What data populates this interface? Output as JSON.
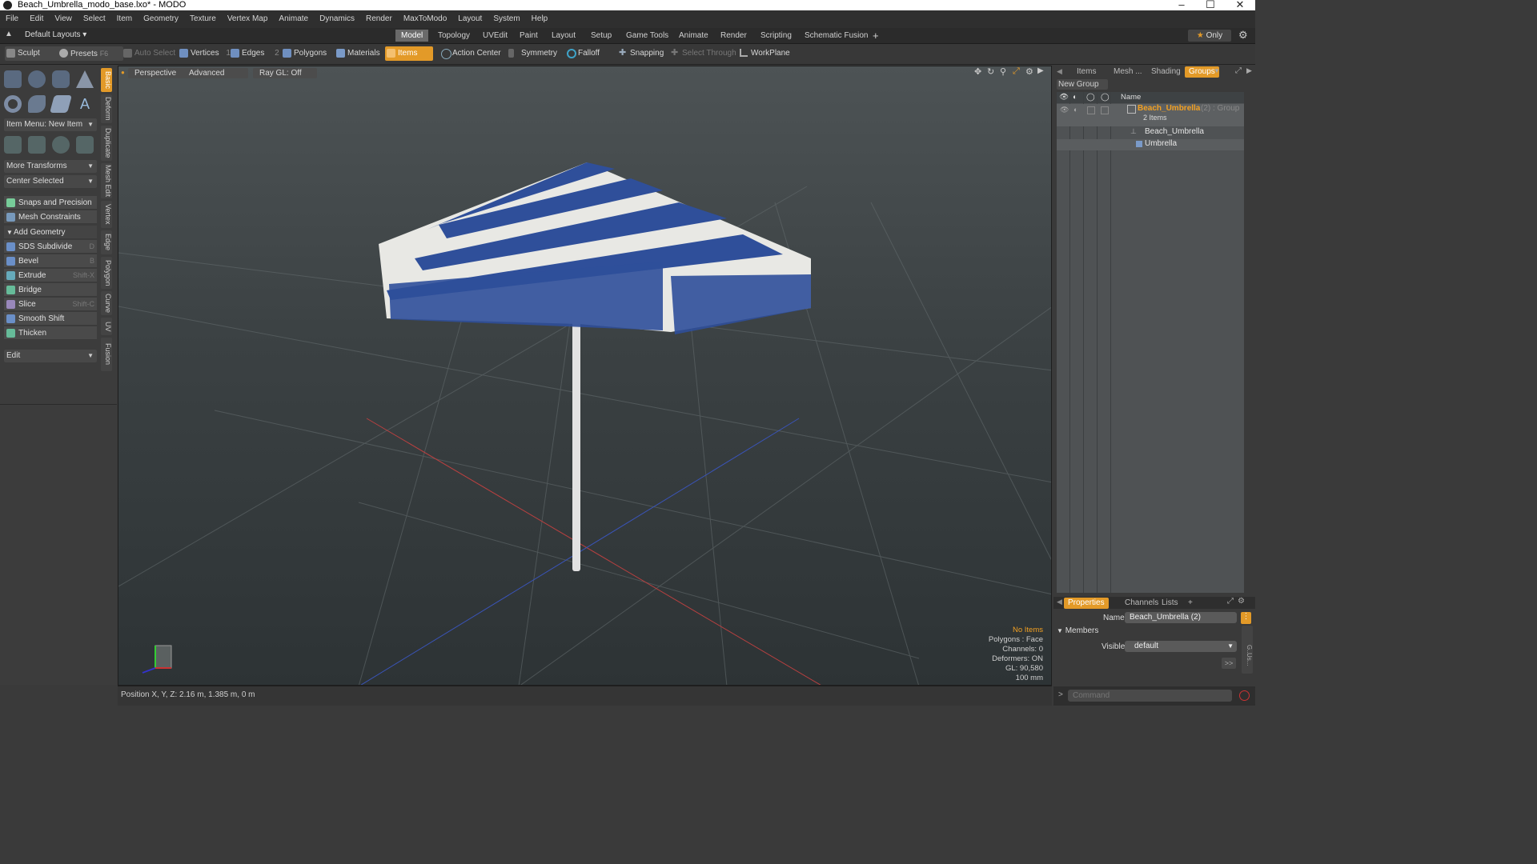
{
  "window": {
    "title": "Beach_Umbrella_modo_base.lxo* - MODO"
  },
  "menu": [
    "File",
    "Edit",
    "View",
    "Select",
    "Item",
    "Geometry",
    "Texture",
    "Vertex Map",
    "Animate",
    "Dynamics",
    "Render",
    "MaxToModo",
    "Layout",
    "System",
    "Help"
  ],
  "layoutbar": {
    "default_layouts": "Default Layouts",
    "tabs": [
      "Model",
      "Topology",
      "UVEdit",
      "Paint",
      "Layout",
      "Setup",
      "Game Tools",
      "Animate",
      "Render",
      "Scripting",
      "Schematic Fusion"
    ],
    "active_tab": "Model",
    "plus": "+",
    "only": "Only",
    "star": "★"
  },
  "toolbar": {
    "sculpt": "Sculpt",
    "presets": "Presets",
    "presets_key": "F6",
    "auto_select": "Auto Select",
    "vertices": "Vertices",
    "vertices_count": "1",
    "edges": "Edges",
    "edges_count": "2",
    "polygons": "Polygons",
    "materials": "Materials",
    "items": "Items",
    "action_center": "Action Center",
    "symmetry": "Symmetry",
    "falloff": "Falloff",
    "snapping": "Snapping",
    "select_through": "Select Through",
    "workplane": "WorkPlane"
  },
  "leftpanel": {
    "item_menu": "Item Menu: New Item",
    "more_transforms": "More Transforms",
    "center_selected": "Center Selected",
    "snaps": "Snaps and Precision",
    "mesh_constraints": "Mesh Constraints",
    "add_geometry": "Add Geometry",
    "tools": [
      {
        "label": "SDS Subdivide",
        "key": "D"
      },
      {
        "label": "Bevel",
        "key": "B"
      },
      {
        "label": "Extrude",
        "key": "Shift-X"
      },
      {
        "label": "Bridge",
        "key": ""
      },
      {
        "label": "Slice",
        "key": "Shift-C"
      },
      {
        "label": "Smooth Shift",
        "key": ""
      },
      {
        "label": "Thicken",
        "key": ""
      }
    ],
    "edit": "Edit",
    "vtabs": [
      "Basic",
      "Deform",
      "Duplicate",
      "Mesh Edit",
      "Vertex",
      "Edge",
      "Polygon",
      "Curve",
      "UV",
      "Fusion"
    ]
  },
  "viewport": {
    "tabs": [
      "Perspective",
      "Advanced",
      "Ray GL: Off"
    ],
    "info": {
      "no_items": "No Items",
      "polygons": "Polygons : Face",
      "channels": "Channels: 0",
      "deformers": "Deformers: ON",
      "gl": "GL: 90,580",
      "scale": "100 mm"
    },
    "colors": {
      "stripe_blue": "#2f4f9a",
      "stripe_white": "#e8e8e4"
    }
  },
  "status": {
    "position": "Position X, Y, Z:   2.16 m, 1.385 m, 0 m"
  },
  "rightpanel": {
    "tabs": [
      "Items",
      "Mesh ...",
      "Shading",
      "Groups"
    ],
    "active_tab": "Groups",
    "new_group": "New Group",
    "col_name": "Name",
    "group_name": "Beach_Umbrella",
    "group_suffix": "(2) : Group",
    "group_count": "2 Items",
    "children": [
      "Beach_Umbrella",
      "Umbrella"
    ],
    "prop_tabs": [
      "Properties",
      "Channels",
      "Lists"
    ],
    "prop_plus": "+",
    "name_label": "Name",
    "name_value": "Beach_Umbrella (2)",
    "members": "Members",
    "visible_label": "Visible",
    "visible_value": "default",
    "expand": ">>",
    "command_placeholder": "Command",
    "side_labels": [
      "G...",
      "Us..."
    ]
  }
}
